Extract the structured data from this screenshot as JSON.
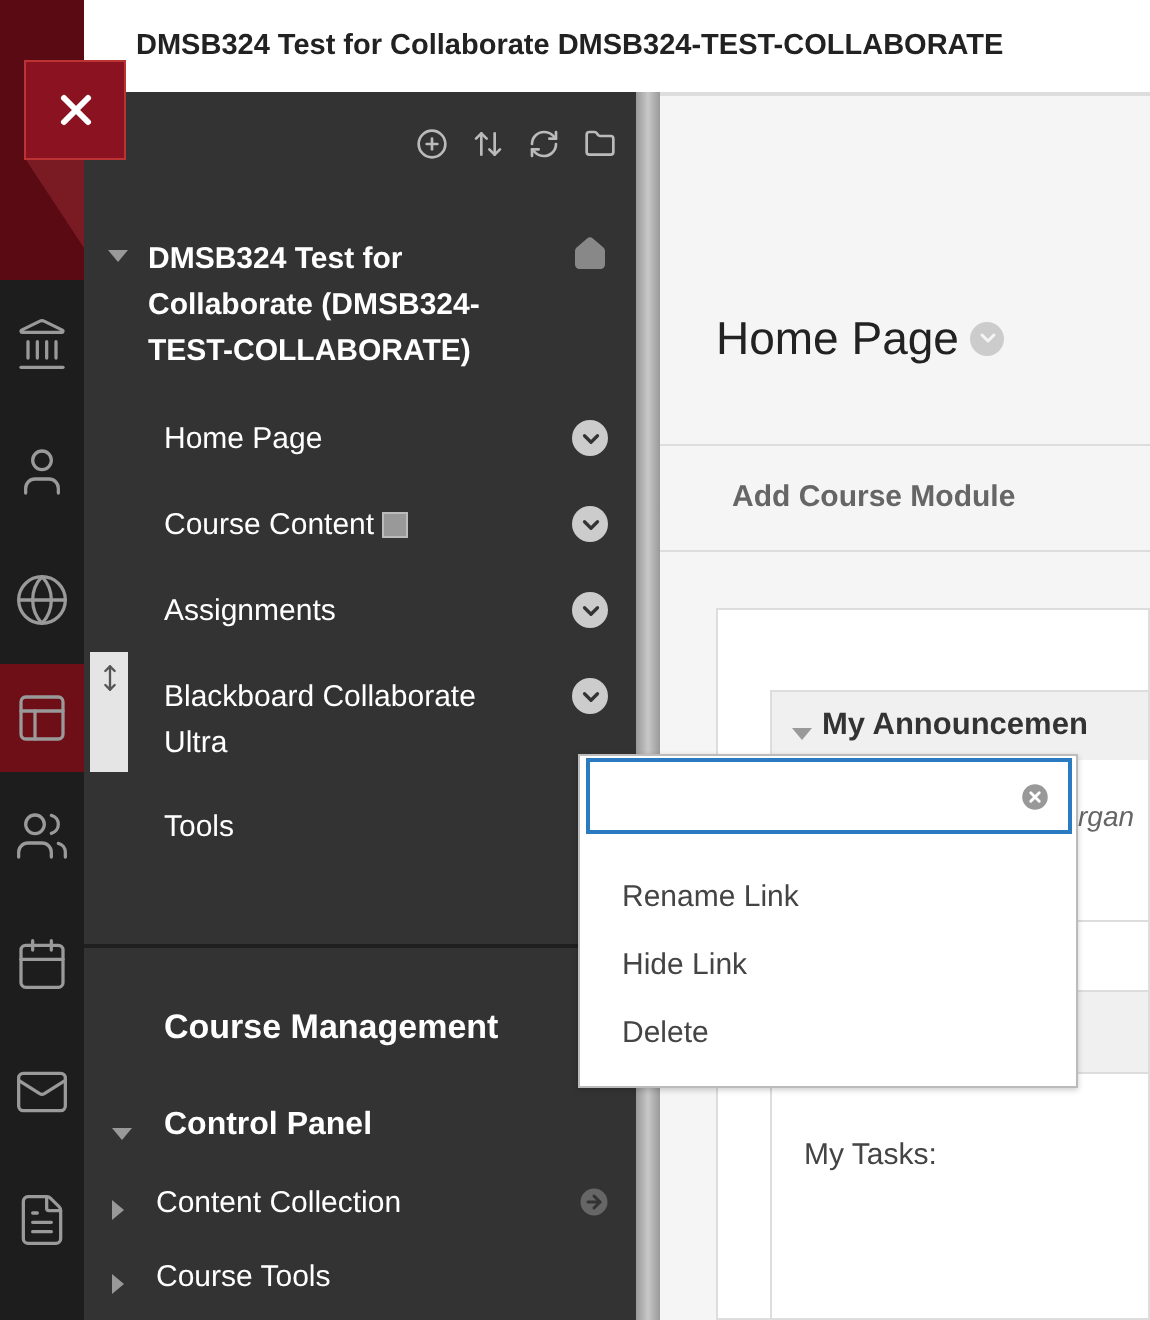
{
  "page_title": "DMSB324 Test for Collaborate DMSB324-TEST-COLLABORATE",
  "rail": [
    {
      "kind": "bank",
      "selected": false
    },
    {
      "kind": "person",
      "selected": false
    },
    {
      "kind": "globe",
      "selected": false
    },
    {
      "kind": "window",
      "selected": true
    },
    {
      "kind": "people",
      "selected": false
    },
    {
      "kind": "calendar",
      "selected": false
    },
    {
      "kind": "mail",
      "selected": false
    },
    {
      "kind": "document",
      "selected": false
    }
  ],
  "course_menu": {
    "title": "DMSB324 Test for Collaborate (DMSB324-TEST-COLLABORATE)",
    "expanded": true,
    "items": [
      {
        "label": "Home Page",
        "content_icon": false,
        "menu": true
      },
      {
        "label": "Course Content",
        "content_icon": true,
        "menu": true
      },
      {
        "label": "Assignments",
        "content_icon": false,
        "menu": true
      },
      {
        "label": "Blackboard Collaborate Ultra",
        "content_icon": false,
        "menu": true
      },
      {
        "label": "Tools",
        "content_icon": false,
        "menu": false
      }
    ]
  },
  "course_management": {
    "title": "Course Management",
    "control_panel": {
      "label": "Control Panel",
      "expanded": true,
      "children": [
        {
          "label": "Content Collection",
          "expanded": false,
          "go_icon": true
        },
        {
          "label": "Course Tools",
          "expanded": false,
          "go_icon": false
        }
      ]
    }
  },
  "main": {
    "title": "Home Page",
    "add_module": "Add Course Module",
    "announcements": {
      "title": "My Announcemen",
      "expanded": true,
      "fragment": "rgan"
    },
    "tasks_label": "My Tasks:"
  },
  "context_menu": {
    "items": [
      "Rename Link",
      "Hide Link",
      "Delete"
    ]
  }
}
